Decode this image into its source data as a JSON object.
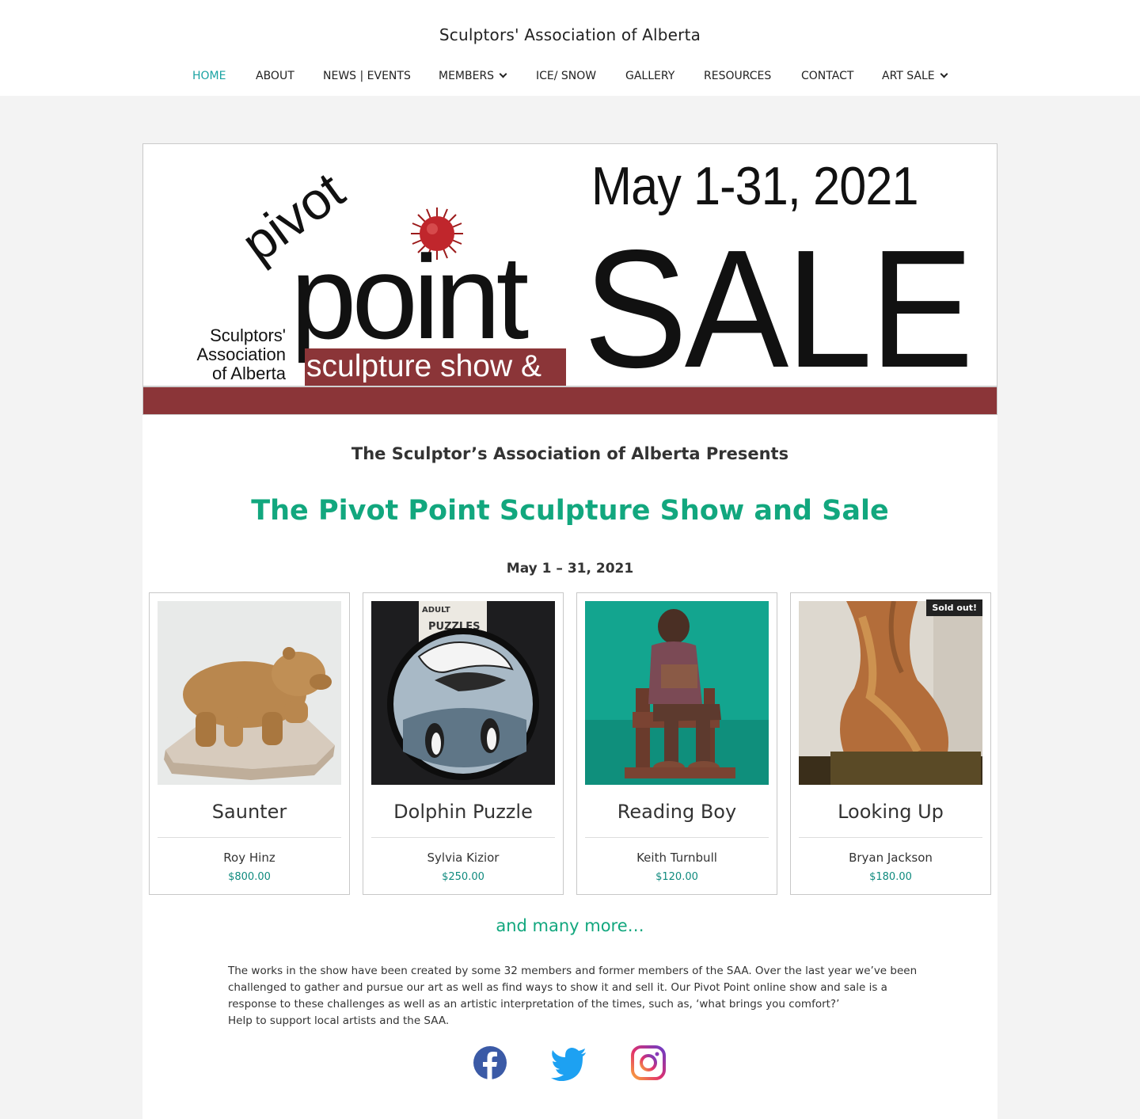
{
  "site": {
    "title": "Sculptors' Association of Alberta"
  },
  "nav": [
    {
      "label": "HOME",
      "active": true,
      "dropdown": false
    },
    {
      "label": "ABOUT",
      "active": false,
      "dropdown": false
    },
    {
      "label": "NEWS | EVENTS",
      "active": false,
      "dropdown": false
    },
    {
      "label": "MEMBERS",
      "active": false,
      "dropdown": true
    },
    {
      "label": "ICE/ SNOW",
      "active": false,
      "dropdown": false
    },
    {
      "label": "GALLERY",
      "active": false,
      "dropdown": false
    },
    {
      "label": "RESOURCES",
      "active": false,
      "dropdown": false
    },
    {
      "label": "CONTACT",
      "active": false,
      "dropdown": false
    },
    {
      "label": "ART SALE",
      "active": false,
      "dropdown": true
    }
  ],
  "banner": {
    "date": "May 1-31, 2021",
    "word_sale": "SALE",
    "word_point": "point",
    "word_pivot": "pivot",
    "association_lines": [
      "Sculptors'",
      "Association",
      "of Alberta"
    ],
    "strip_text": "sculpture show &"
  },
  "main": {
    "presents": "The Sculptor’s Association of Alberta Presents",
    "title": "The Pivot Point Sculpture Show and Sale",
    "dates": "May 1 – 31, 2021",
    "many_more": "and many more…",
    "body": [
      "The works in the show have been created by some 32 members and former members of the SAA. Over the last year we’ve been challenged to gather and pursue our art as well as find ways to show it and sell it. Our Pivot Point online show and sale is a response to these challenges as well as an artistic interpretation of the times, such as, ‘what brings you comfort?’",
      "Help to support local artists and the SAA."
    ]
  },
  "products": [
    {
      "name": "Saunter",
      "artist": "Roy Hinz",
      "price": "$800.00",
      "badge": ""
    },
    {
      "name": "Dolphin Puzzle",
      "artist": "Sylvia Kizior",
      "price": "$250.00",
      "badge": ""
    },
    {
      "name": "Reading Boy",
      "artist": "Keith Turnbull",
      "price": "$120.00",
      "badge": ""
    },
    {
      "name": "Looking Up",
      "artist": "Bryan Jackson",
      "price": "$180.00",
      "badge": "Sold out!"
    }
  ],
  "puzzle_box": {
    "line1": "ADULT",
    "line2": "PUZZLES"
  },
  "social": [
    "facebook-icon",
    "twitter-icon",
    "instagram-icon"
  ],
  "colors": {
    "accent_teal": "#1aa3a3",
    "title_green": "#12a77e",
    "price_teal": "#0f8a7e",
    "banner_red": "#8b3538"
  }
}
